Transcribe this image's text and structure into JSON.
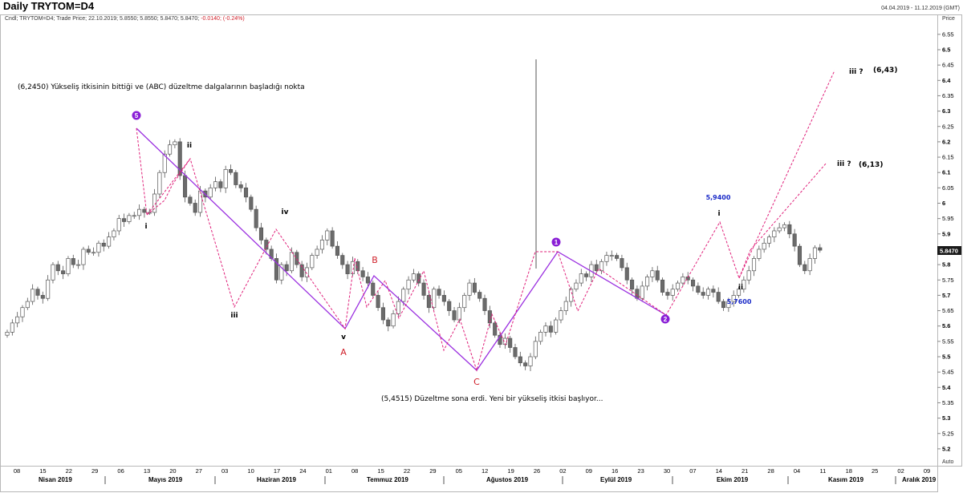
{
  "header": {
    "title": "Daily TRYTOM=D4",
    "date_range": "04.04.2019 - 11.12.2019 (GMT)",
    "legend_line": "Cndl; TRYTOM=D4; Trade Price; 22.10.2019; 5.8550; 5.8550; 5.8470; 5.8470; ",
    "legend_change": "-0.0140; (-0.24%)",
    "price_label": "Price",
    "auto_label": "Auto",
    "last_price": "5.8470"
  },
  "colors": {
    "candle": "#6b6b6b",
    "wave_solid": "#9b30e0",
    "wave_dashed": "#e0207a",
    "badge": "#8a1fd6",
    "text_red": "#d0202a",
    "text_blue": "#1a2ac8"
  },
  "annotations": {
    "top_note": "(6,2450) Yükseliş itkisinin bittiği ve (ABC) düzeltme dalgalarının başladığı nokta",
    "bottom_note": "(5,4515)  Düzeltme sona erdi. Yeni bir yükseliş itkisi başlıyor...",
    "target_high": "(6,43)",
    "target_low": "(6,13)",
    "peak_value": "5,9400",
    "trough_value": "5,7600",
    "label_iii_q": "iii ?",
    "label_ii_q": "iii ?"
  },
  "chart_data": {
    "type": "candlestick",
    "title": "Daily TRYTOM=D4",
    "ylabel": "Price",
    "ylim": [
      5.15,
      6.6
    ],
    "y_ticks": [
      "6.55",
      "6.5",
      "6.45",
      "6.4",
      "6.35",
      "6.3",
      "6.25",
      "6.2",
      "6.15",
      "6.1",
      "6.05",
      "6",
      "5.95",
      "5.9",
      "5.85",
      "5.8",
      "5.75",
      "5.7",
      "5.65",
      "5.6",
      "5.55",
      "5.5",
      "5.45",
      "5.4",
      "5.35",
      "5.3",
      "5.25",
      "5.2"
    ],
    "x_day_ticks": [
      "08",
      "15",
      "22",
      "29",
      "06",
      "13",
      "20",
      "27",
      "03",
      "10",
      "17",
      "24",
      "01",
      "08",
      "15",
      "22",
      "29",
      "05",
      "12",
      "19",
      "26",
      "02",
      "09",
      "16",
      "23",
      "30",
      "07",
      "14",
      "21",
      "28",
      "04",
      "11",
      "18",
      "25",
      "02",
      "09"
    ],
    "x_month_labels": [
      "Nisan 2019",
      "Mayıs 2019",
      "Haziran 2019",
      "Temmuz 2019",
      "Ağustos 2019",
      "Eylül 2019",
      "Ekim 2019",
      "Kasım 2019",
      "Aralık 2019"
    ],
    "wave_labels": [
      "5",
      "ii",
      "i",
      "iii",
      "iv",
      "v",
      "A",
      "B",
      "C",
      "1",
      "2",
      "i",
      "ii"
    ],
    "grid": false,
    "legend": "top-left",
    "closes": [
      5.58,
      5.61,
      5.63,
      5.66,
      5.68,
      5.72,
      5.7,
      5.69,
      5.75,
      5.8,
      5.78,
      5.77,
      5.82,
      5.8,
      5.8,
      5.85,
      5.84,
      5.84,
      5.87,
      5.86,
      5.89,
      5.91,
      5.95,
      5.94,
      5.96,
      5.96,
      5.98,
      5.97,
      5.97,
      6.03,
      6.1,
      6.16,
      6.19,
      6.2,
      6.09,
      6.02,
      6.0,
      5.97,
      6.04,
      6.02,
      6.05,
      6.07,
      6.05,
      6.11,
      6.1,
      6.06,
      6.05,
      6.02,
      5.98,
      5.92,
      5.88,
      5.85,
      5.82,
      5.75,
      5.8,
      5.78,
      5.84,
      5.8,
      5.76,
      5.79,
      5.83,
      5.85,
      5.88,
      5.91,
      5.86,
      5.83,
      5.8,
      5.77,
      5.81,
      5.78,
      5.76,
      5.74,
      5.7,
      5.66,
      5.62,
      5.6,
      5.64,
      5.68,
      5.72,
      5.75,
      5.77,
      5.74,
      5.7,
      5.66,
      5.72,
      5.7,
      5.68,
      5.65,
      5.62,
      5.66,
      5.7,
      5.74,
      5.71,
      5.69,
      5.65,
      5.61,
      5.57,
      5.54,
      5.56,
      5.53,
      5.5,
      5.48,
      5.47,
      5.5,
      5.55,
      5.58,
      5.6,
      5.58,
      5.62,
      5.65,
      5.68,
      5.72,
      5.74,
      5.77,
      5.76,
      5.8,
      5.78,
      5.81,
      5.83,
      5.83,
      5.82,
      5.79,
      5.75,
      5.72,
      5.69,
      5.73,
      5.76,
      5.78,
      5.75,
      5.71,
      5.7,
      5.72,
      5.74,
      5.76,
      5.75,
      5.73,
      5.71,
      5.7,
      5.72,
      5.71,
      5.68,
      5.66,
      5.68,
      5.7,
      5.72,
      5.75,
      5.78,
      5.82,
      5.85,
      5.87,
      5.89,
      5.91,
      5.92,
      5.93,
      5.9,
      5.86,
      5.8,
      5.78,
      5.82,
      5.855,
      5.847
    ]
  }
}
